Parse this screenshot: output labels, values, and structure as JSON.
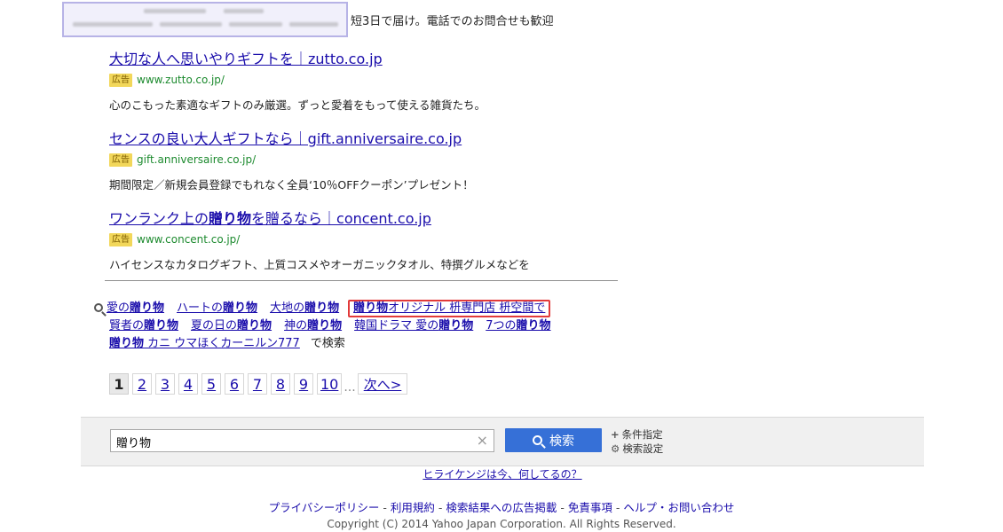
{
  "top_snippet": "短3日で届け。電話でのお問合せも歓迎",
  "ads": [
    {
      "title": "大切な人へ思いやりギフトを｜zutto.co.jp",
      "badge": "広告",
      "url": "www.zutto.co.jp/",
      "desc": "心のこもった素適なギフトのみ厳選。ずっと愛着をもって使える雑貨たち。"
    },
    {
      "title": "センスの良い大人ギフトなら｜gift.anniversaire.co.jp",
      "badge": "広告",
      "url": "gift.anniversaire.co.jp/",
      "desc": "期間限定／新規会員登録でもれなく全員‘10％OFFクーポン’プレゼント！"
    },
    {
      "title_pre": "ワンランク上の",
      "title_bold": "贈り物",
      "title_post": "を贈るなら｜concent.co.jp",
      "badge": "広告",
      "url": "www.concent.co.jp/",
      "desc": "ハイセンスなカタログギフト、上質コスメやオーガニックタオル、特撰グルメなどを"
    }
  ],
  "related": {
    "row1": [
      {
        "pre": "愛の",
        "bold": "贈り物",
        "post": ""
      },
      {
        "pre": "ハートの",
        "bold": "贈り物",
        "post": ""
      },
      {
        "pre": "大地の",
        "bold": "贈り物",
        "post": ""
      },
      {
        "pre": "",
        "bold": "贈り物",
        "post": "オリジナル 枡専門店 枡空間で"
      }
    ],
    "row2": [
      {
        "pre": "賢者の",
        "bold": "贈り物",
        "post": ""
      },
      {
        "pre": "夏の日の",
        "bold": "贈り物",
        "post": ""
      },
      {
        "pre": "神の",
        "bold": "贈り物",
        "post": ""
      },
      {
        "pre": "韓国ドラマ 愛の",
        "bold": "贈り物",
        "post": ""
      },
      {
        "pre": "7つの",
        "bold": "贈り物",
        "post": ""
      }
    ],
    "row3": {
      "bold": "贈り物",
      "post": " カニ ウマほくカーニルン777"
    },
    "suffix": "で検索"
  },
  "pagination": {
    "current": "1",
    "pages": [
      "2",
      "3",
      "4",
      "5",
      "6",
      "7",
      "8",
      "9",
      "10"
    ],
    "ellipsis": "...",
    "next": "次へ>"
  },
  "search": {
    "value": "贈り物",
    "clear": "×",
    "button": "検索",
    "opt1": "条件指定",
    "opt2": "検索設定"
  },
  "hirai": {
    "pre": "",
    "link": "ヒライケンジは今、何してるの？"
  },
  "footer": {
    "links": [
      "プライバシーポリシー",
      "利用規約",
      "検索結果への広告掲載",
      "免責事項",
      "ヘルプ・お問い合わせ"
    ],
    "sep": " - ",
    "copyright": "Copyright (C) 2014 Yahoo Japan Corporation. All Rights Reserved."
  }
}
